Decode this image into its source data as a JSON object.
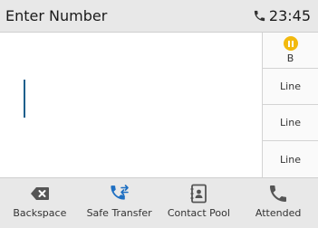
{
  "header": {
    "title": "Enter Number",
    "time": "23:45"
  },
  "line_keys": [
    {
      "label": "B",
      "icon": "hold-icon",
      "status_color": "#f2b90f"
    },
    {
      "label": "Line"
    },
    {
      "label": "Line"
    },
    {
      "label": "Line"
    }
  ],
  "softkeys": [
    {
      "label": "Backspace",
      "icon": "backspace-icon"
    },
    {
      "label": "Safe Transfer",
      "icon": "transfer-icon"
    },
    {
      "label": "Contact Pool",
      "icon": "contacts-icon"
    },
    {
      "label": "Attended",
      "icon": "phone-icon"
    }
  ],
  "colors": {
    "accent": "#1e6fc2",
    "icon_gray": "#555555",
    "hold": "#f2b90f"
  }
}
